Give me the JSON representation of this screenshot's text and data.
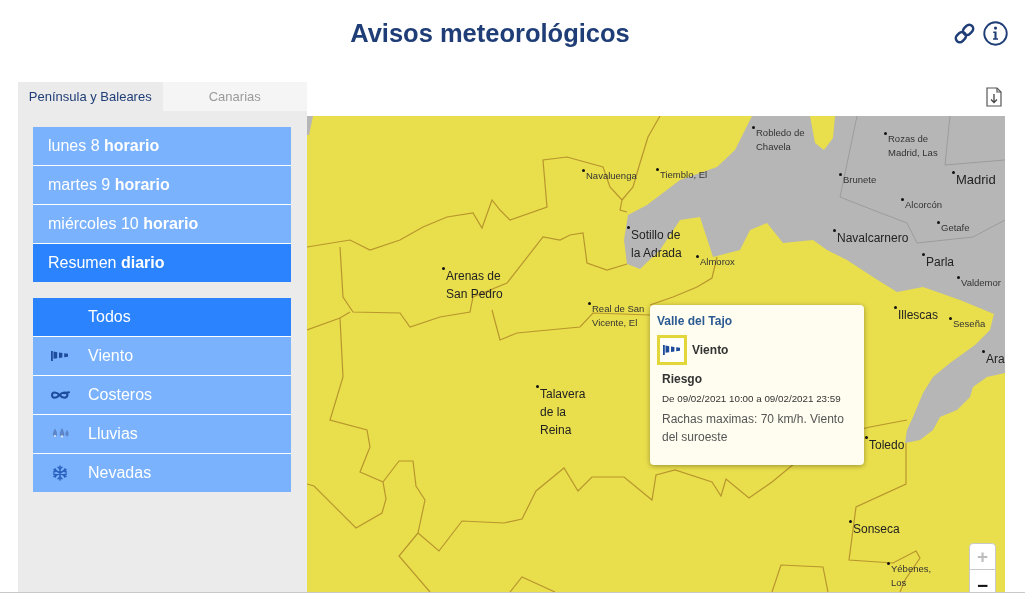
{
  "header": {
    "title": "Avisos meteorológicos"
  },
  "region_tabs": [
    {
      "label": "Península y Baleares",
      "selected": true
    },
    {
      "label": "Canarias",
      "selected": false
    }
  ],
  "day_menu": [
    {
      "label": "lunes 8 **horario**",
      "selected": false
    },
    {
      "label": "martes 9 **horario**",
      "selected": false
    },
    {
      "label": "miércoles 10 **horario**",
      "selected": false
    },
    {
      "label": "Resumen **diario**",
      "selected": true
    }
  ],
  "phenomenon_menu": [
    {
      "label": "Todos",
      "kind": "all",
      "selected": true
    },
    {
      "label": "Viento",
      "kind": "wind",
      "selected": false
    },
    {
      "label": "Costeros",
      "kind": "coastal",
      "selected": false
    },
    {
      "label": "Lluvias",
      "kind": "rain",
      "selected": false
    },
    {
      "label": "Nevadas",
      "kind": "snow",
      "selected": false
    }
  ],
  "map": {
    "places": [
      {
        "name": "Robledo de Chavela",
        "kind": "village"
      },
      {
        "name": "Rozas de Madrid, Las",
        "kind": "village"
      },
      {
        "name": "Navaluenga",
        "kind": "village"
      },
      {
        "name": "Tiemblo, El",
        "kind": "village"
      },
      {
        "name": "Brunete",
        "kind": "village"
      },
      {
        "name": "Madrid",
        "kind": "capital"
      },
      {
        "name": "Alcorcón",
        "kind": "village"
      },
      {
        "name": "Getafe",
        "kind": "village"
      },
      {
        "name": "Sotillo de la Adrada",
        "kind": "town"
      },
      {
        "name": "Navalcarnero",
        "kind": "town"
      },
      {
        "name": "Parla",
        "kind": "town"
      },
      {
        "name": "Almorox",
        "kind": "village"
      },
      {
        "name": "Arenas de San Pedro",
        "kind": "town"
      },
      {
        "name": "Valdemor",
        "kind": "village"
      },
      {
        "name": "Real de San Vicente, El",
        "kind": "village"
      },
      {
        "name": "Illescas",
        "kind": "town"
      },
      {
        "name": "Seseña",
        "kind": "village"
      },
      {
        "name": "Ara",
        "kind": "town"
      },
      {
        "name": "Talavera de la Reina",
        "kind": "town"
      },
      {
        "name": "Toledo",
        "kind": "town"
      },
      {
        "name": "Sonseca",
        "kind": "town"
      },
      {
        "name": "Yébenes, Los",
        "kind": "village"
      }
    ],
    "popup": {
      "zone": "Valle del Tajo",
      "kind": "wind",
      "phenomenon": "Viento",
      "risk": "Riesgo",
      "period": "De 09/02/2021 10:00 a 09/02/2021 23:59",
      "description": "Rachas maximas: 70 km/h. Viento del suroeste"
    },
    "zoom_controls": [
      {
        "label": "+",
        "disabled": true
      },
      {
        "label": "−",
        "disabled": false
      }
    ]
  }
}
